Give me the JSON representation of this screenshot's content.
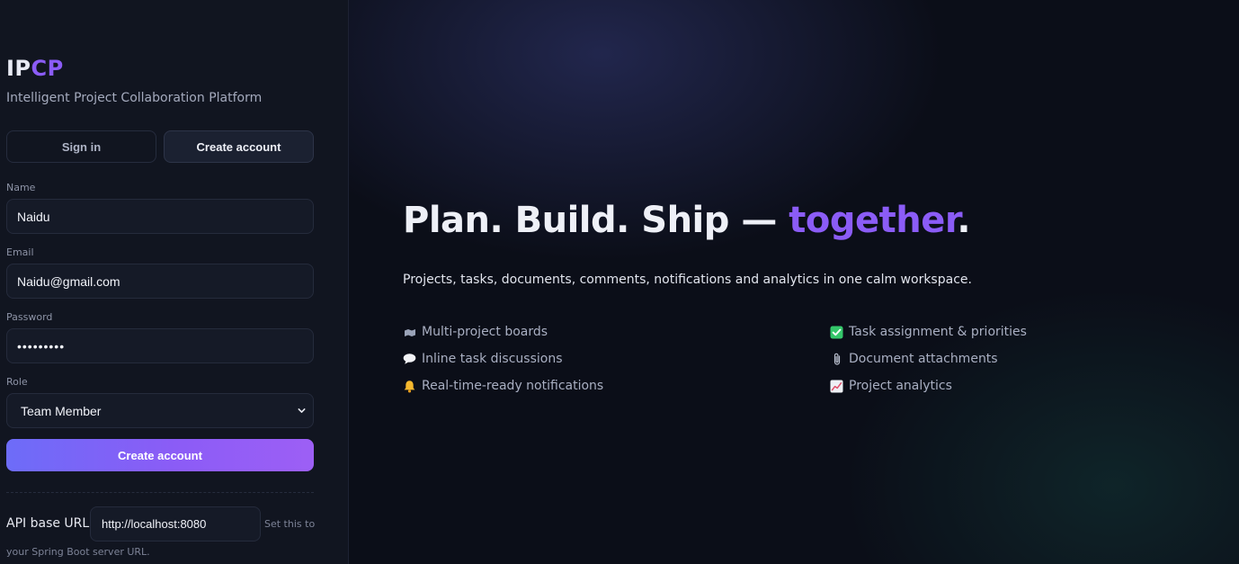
{
  "brand": {
    "part1": "IP",
    "part2": "CP",
    "subtitle": "Intelligent Project Collaboration Platform"
  },
  "auth_tabs": {
    "signin": "Sign in",
    "create": "Create account",
    "active": "create"
  },
  "form": {
    "name_label": "Name",
    "name_value": "Naidu",
    "email_label": "Email",
    "email_value": "Naidu@gmail.com",
    "password_label": "Password",
    "password_value": "•••••••••",
    "role_label": "Role",
    "role_value": "Team Member",
    "submit_label": "Create account"
  },
  "api": {
    "label": "API base URL",
    "value": "http://localhost:8080",
    "hint_part1": "Set this to",
    "hint_part2": "your Spring Boot server URL."
  },
  "hero": {
    "headline_main": "Plan. Build. Ship — ",
    "headline_accent": "together",
    "headline_end": ".",
    "tagline": "Projects, tasks, documents, comments, notifications and analytics in one calm workspace."
  },
  "features": [
    {
      "icon": "boards-icon",
      "text": "Multi-project boards"
    },
    {
      "icon": "check-box-icon",
      "text": "Task assignment & priorities"
    },
    {
      "icon": "speech-bubble-icon",
      "text": "Inline task discussions"
    },
    {
      "icon": "paperclip-icon",
      "text": "Document attachments"
    },
    {
      "icon": "bell-icon",
      "text": "Real-time-ready notifications"
    },
    {
      "icon": "chart-icon",
      "text": "Project analytics"
    }
  ],
  "colors": {
    "accent": "#8b5cf6",
    "panel": "#111520",
    "background": "#0b0e18"
  }
}
